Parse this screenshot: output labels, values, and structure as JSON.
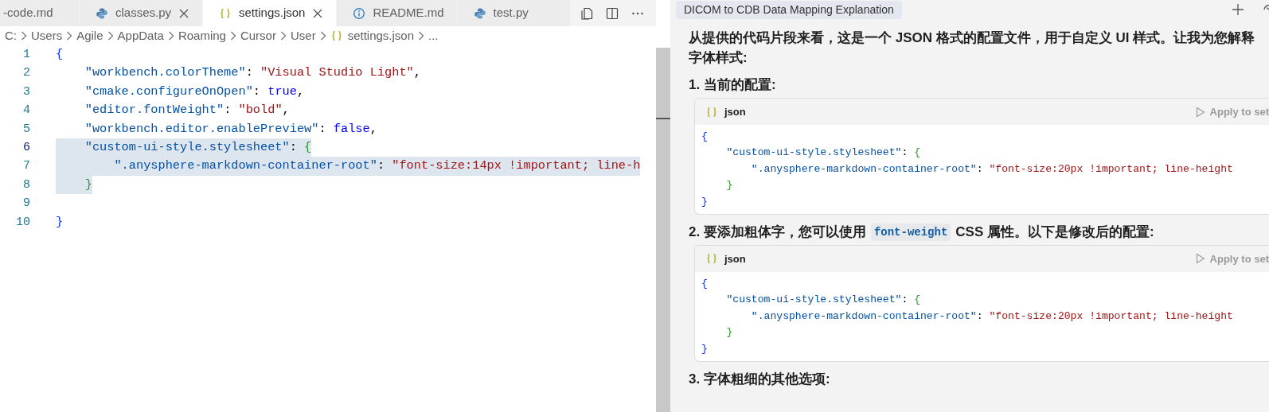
{
  "editor": {
    "tabs": [
      {
        "label": "-code.md",
        "kind": "plain",
        "selected": false,
        "closable": false
      },
      {
        "label": "classes.py",
        "kind": "python",
        "selected": false,
        "closable": true
      },
      {
        "label": "settings.json",
        "kind": "json",
        "selected": true,
        "closable": true
      },
      {
        "label": "README.md",
        "kind": "info",
        "selected": false,
        "closable": false
      },
      {
        "label": "test.py",
        "kind": "python",
        "selected": false,
        "closable": false
      }
    ],
    "breadcrumb": [
      {
        "label": "C:",
        "kind": "folder"
      },
      {
        "label": "Users",
        "kind": "folder"
      },
      {
        "label": "Agile",
        "kind": "folder"
      },
      {
        "label": "AppData",
        "kind": "folder"
      },
      {
        "label": "Roaming",
        "kind": "folder"
      },
      {
        "label": "Cursor",
        "kind": "folder"
      },
      {
        "label": "User",
        "kind": "folder"
      },
      {
        "label": "settings.json",
        "kind": "json"
      },
      {
        "label": "...",
        "kind": "folder"
      }
    ],
    "lines": [
      {
        "number": "1",
        "active": false,
        "selected": false,
        "tokens": [
          {
            "kind": "brace1",
            "text": "{"
          }
        ],
        "children": [
          {
            "number": "2",
            "active": false,
            "selected": false,
            "tokens": [
              {
                "kind": "key",
                "text": "\"workbench.colorTheme\""
              },
              {
                "kind": "punct",
                "text": ": "
              },
              {
                "kind": "string",
                "text": "\"Visual Studio Light\""
              },
              {
                "kind": "punct",
                "text": ","
              }
            ]
          },
          {
            "number": "3",
            "active": false,
            "selected": false,
            "tokens": [
              {
                "kind": "key",
                "text": "\"cmake.configureOnOpen\""
              },
              {
                "kind": "punct",
                "text": ": "
              },
              {
                "kind": "keyword",
                "text": "true"
              },
              {
                "kind": "punct",
                "text": ","
              }
            ]
          },
          {
            "number": "4",
            "active": false,
            "selected": false,
            "tokens": [
              {
                "kind": "key",
                "text": "\"editor.fontWeight\""
              },
              {
                "kind": "punct",
                "text": ": "
              },
              {
                "kind": "string",
                "text": "\"bold\""
              },
              {
                "kind": "punct",
                "text": ","
              }
            ]
          },
          {
            "number": "5",
            "active": false,
            "selected": false,
            "tokens": [
              {
                "kind": "key",
                "text": "\"workbench.editor.enablePreview\""
              },
              {
                "kind": "punct",
                "text": ": "
              },
              {
                "kind": "keyword",
                "text": "false"
              },
              {
                "kind": "punct",
                "text": ","
              }
            ]
          },
          {
            "number": "6",
            "active": true,
            "selected": true,
            "tokens": [
              {
                "kind": "key",
                "text": "\"custom-ui-style.stylesheet\""
              },
              {
                "kind": "punct",
                "text": ": "
              },
              {
                "kind": "brace2",
                "text": "{"
              }
            ],
            "children": [
              {
                "number": "7",
                "active": false,
                "selected": true,
                "tokens": [
                  {
                    "kind": "key",
                    "text": "\".anysphere-markdown-container-root\""
                  },
                  {
                    "kind": "punct",
                    "text": ": "
                  },
                  {
                    "kind": "string",
                    "text": "\"font-size:14px !important; line-h"
                  }
                ]
              }
            ]
          },
          {
            "number": "8",
            "active": false,
            "selected": true,
            "tokens": [
              {
                "kind": "brace2",
                "text": "}"
              }
            ]
          },
          {
            "number": "9",
            "active": false,
            "selected": false
          }
        ]
      },
      {
        "number": "10",
        "active": false,
        "selected": false,
        "tokens": [
          {
            "kind": "brace1",
            "text": "}"
          }
        ]
      }
    ]
  },
  "chat": {
    "title": "DICOM to CDB Data Mapping Explanation",
    "blocks": [
      {
        "kind": "paragraph",
        "lines": [
          "从提供的代码片段来看，这是一个 JSON 格式的配置文件，用于自定义 UI 样式。让我为您解释",
          "字体样式:"
        ]
      },
      {
        "kind": "heading",
        "parts": [
          {
            "text": "1. 当前的配置:",
            "code": false
          }
        ]
      },
      {
        "kind": "code",
        "language": "json",
        "action": "Apply to set",
        "lines": [
          {
            "tokens": [
              {
                "kind": "brace1",
                "text": "{"
              }
            ],
            "children": [
              {
                "tokens": [
                  {
                    "kind": "key",
                    "text": "\"custom-ui-style.stylesheet\""
                  },
                  {
                    "kind": "punct",
                    "text": ": "
                  },
                  {
                    "kind": "brace2",
                    "text": "{"
                  }
                ],
                "children": [
                  {
                    "tokens": [
                      {
                        "kind": "key",
                        "text": "\".anysphere-markdown-container-root\""
                      },
                      {
                        "kind": "punct",
                        "text": ": "
                      },
                      {
                        "kind": "string",
                        "text": "\"font-size:20px !important; line-height"
                      }
                    ]
                  }
                ]
              },
              {
                "tokens": [
                  {
                    "kind": "brace2",
                    "text": "}"
                  }
                ]
              }
            ]
          },
          {
            "tokens": [
              {
                "kind": "brace1",
                "text": "}"
              }
            ]
          }
        ]
      },
      {
        "kind": "heading",
        "parts": [
          {
            "text": "2. 要添加粗体字，您可以使用",
            "code": false
          },
          {
            "text": "font-weight",
            "code": true
          },
          {
            "text": "CSS 属性。以下是修改后的配置:",
            "code": false
          }
        ]
      },
      {
        "kind": "code",
        "language": "json",
        "action": "Apply to set",
        "lines": [
          {
            "tokens": [
              {
                "kind": "brace1",
                "text": "{"
              }
            ],
            "children": [
              {
                "tokens": [
                  {
                    "kind": "key",
                    "text": "\"custom-ui-style.stylesheet\""
                  },
                  {
                    "kind": "punct",
                    "text": ": "
                  },
                  {
                    "kind": "brace2",
                    "text": "{"
                  }
                ],
                "children": [
                  {
                    "tokens": [
                      {
                        "kind": "key",
                        "text": "\".anysphere-markdown-container-root\""
                      },
                      {
                        "kind": "punct",
                        "text": ": "
                      },
                      {
                        "kind": "string",
                        "text": "\"font-size:20px !important; line-height"
                      }
                    ]
                  }
                ]
              },
              {
                "tokens": [
                  {
                    "kind": "brace2",
                    "text": "}"
                  }
                ]
              }
            ]
          },
          {
            "tokens": [
              {
                "kind": "brace1",
                "text": "}"
              }
            ]
          }
        ]
      },
      {
        "kind": "heading",
        "parts": [
          {
            "text": "3. 字体粗细的其他选项:",
            "code": false
          }
        ]
      }
    ]
  }
}
